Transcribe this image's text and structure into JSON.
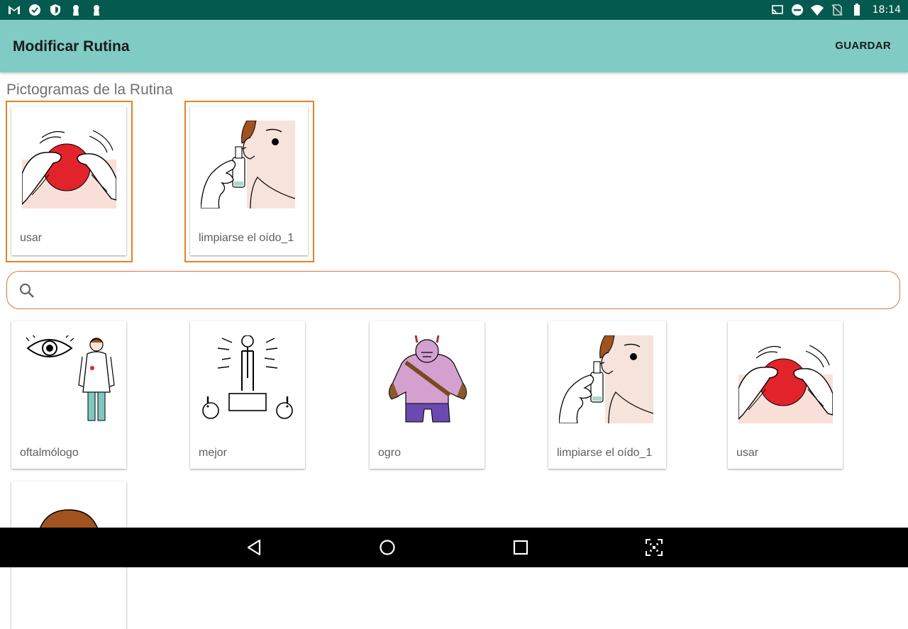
{
  "status_bar": {
    "time": "18:14",
    "left_icons": [
      "gmail-icon",
      "check-circle-icon",
      "shield-icon",
      "keyhole-icon",
      "keyhole-icon"
    ],
    "right_icons": [
      "cast-icon",
      "do-not-disturb-icon",
      "wifi-icon",
      "no-sim-icon",
      "battery-icon"
    ]
  },
  "app_bar": {
    "title": "Modificar Rutina",
    "save_label": "GUARDAR",
    "color": "#80cbc4"
  },
  "routine": {
    "section_title": "Pictogramas de la Rutina",
    "selected_border_color": "#e8821f",
    "items": [
      {
        "label": "usar",
        "pictogram": "hands-red-ball"
      },
      {
        "label": "limpiarse el oído_1",
        "pictogram": "ear-spray"
      }
    ]
  },
  "search": {
    "value": "",
    "placeholder": "",
    "icon": "search-icon"
  },
  "results": {
    "items": [
      {
        "label": "oftalmólogo",
        "pictogram": "eye-doctor"
      },
      {
        "label": "mejor",
        "pictogram": "stick-figure-podium"
      },
      {
        "label": "ogro",
        "pictogram": "purple-ogre"
      },
      {
        "label": "limpiarse el oído_1",
        "pictogram": "ear-spray"
      },
      {
        "label": "usar",
        "pictogram": "hands-red-ball"
      },
      {
        "label": "",
        "pictogram": "brown-hair-head"
      }
    ]
  },
  "nav_bar": {
    "buttons": [
      "back-icon",
      "home-icon",
      "recents-icon",
      "screenshot-icon"
    ]
  }
}
